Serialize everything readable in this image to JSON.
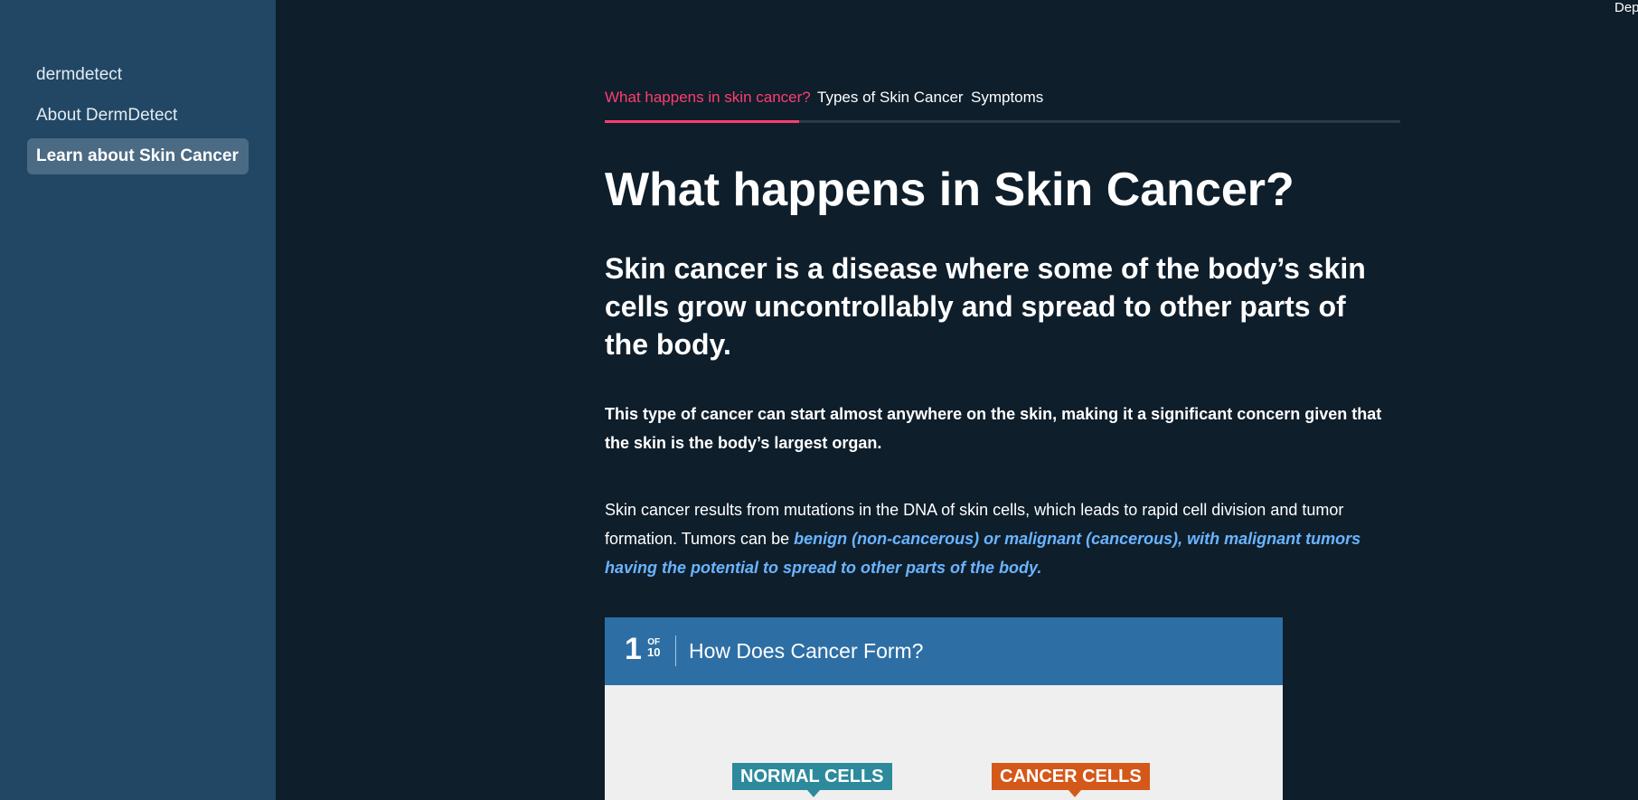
{
  "header": {
    "deploy_label": "Deploy"
  },
  "sidebar": {
    "items": [
      {
        "label": "dermdetect",
        "active": false
      },
      {
        "label": "About DermDetect",
        "active": false
      },
      {
        "label": "Learn about Skin Cancer",
        "active": true
      }
    ]
  },
  "tabs": [
    {
      "label": "What happens in skin cancer?",
      "active": true
    },
    {
      "label": "Types of Skin Cancer",
      "active": false
    },
    {
      "label": "Symptoms",
      "active": false
    }
  ],
  "content": {
    "title": "What happens in Skin Cancer?",
    "subtitle": "Skin cancer is a disease where some of the body’s skin cells grow uncontrollably and spread to other parts of the body.",
    "bold_paragraph": "This type of cancer can start almost anywhere on the skin, making it a significant concern given that the skin is the body’s largest organ.",
    "paragraph_plain": "Skin cancer results from mutations in the DNA of skin cells, which leads to rapid cell division and tumor formation. Tumors can be ",
    "paragraph_emphasis": "benign (non-cancerous) or malignant (cancerous), with malignant tumors having the potential to spread to other parts of the body."
  },
  "infographic": {
    "number": "1",
    "of_label": "OF",
    "total": "10",
    "title": "How Does Cancer Form?",
    "normal_label": "NORMAL CELLS",
    "cancer_label": "CANCER CELLS"
  },
  "colors": {
    "sidebar_bg": "#214764",
    "main_bg": "#0e1e2b",
    "tab_active": "#ff3d6e",
    "link_emphasis": "#6ab4ff",
    "infographic_header": "#2d6fa5",
    "normal_cells": "#2c8a9c",
    "cancer_cells": "#d4581a"
  }
}
